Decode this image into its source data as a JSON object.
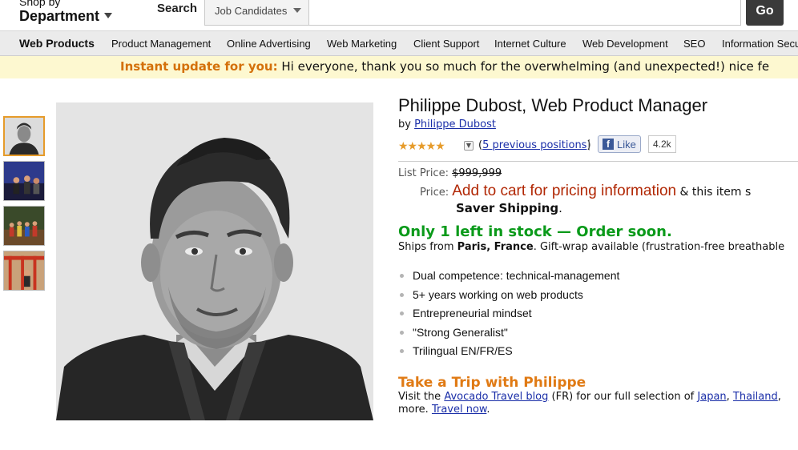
{
  "header": {
    "shop_by": "Shop by",
    "department": "Department",
    "search_label": "Search",
    "scope_value": "Job Candidates",
    "search_value": "",
    "go_label": "Go"
  },
  "nav": {
    "items": [
      "Web Products",
      "Product Management",
      "Online Advertising",
      "Web Marketing",
      "Client Support",
      "Internet Culture",
      "Web Development",
      "SEO",
      "Information Secu"
    ]
  },
  "update": {
    "label": "Instant update for you:",
    "text": " Hi everyone, thank you so much for the overwhelming (and unexpected!) nice fe"
  },
  "product": {
    "title": "Philippe Dubost, Web Product Manager",
    "by_prefix": "by ",
    "author": "Philippe Dubost",
    "stars": "★★★★★",
    "previous_prefix": "(",
    "previous_link": "5 previous positions",
    "previous_suffix": ")",
    "separator": "|",
    "like_label": "Like",
    "like_icon": "f",
    "like_count": "4.2k",
    "list_price_label": "List Price: ",
    "list_price": "$999,999",
    "price_label": "Price: ",
    "price_cta": "Add to cart for pricing information",
    "price_rest": " & this item s",
    "saver_shipping": "Saver Shipping",
    "saver_period": ".",
    "stock": "Only 1 left in stock — Order soon.",
    "ships_prefix": "Ships from ",
    "ships_location": "Paris, France",
    "ships_suffix": ". Gift-wrap available (frustration-free breathable",
    "bullets": [
      "Dual competence: technical-management",
      "5+ years working on web products",
      "Entrepreneurial mindset",
      "\"Strong Generalist\"",
      "Trilingual EN/FR/ES"
    ],
    "trip_title": "Take a Trip with Philippe",
    "trip_text_1": "Visit the ",
    "trip_link_blog": "Avocado Travel blog",
    "trip_text_2": " (FR) for our full selection of ",
    "trip_link_japan": "Japan",
    "trip_text_3": ", ",
    "trip_link_thailand": "Thailand",
    "trip_text_4": ",",
    "trip_text_5": "more. ",
    "trip_link_travel": "Travel now",
    "trip_text_6": "."
  },
  "colors": {
    "accent_orange": "#e07a14",
    "price_red": "#b12704",
    "stock_green": "#0a9a1a",
    "link_blue": "#1a2ea8",
    "update_bg": "#fdf8d0"
  }
}
